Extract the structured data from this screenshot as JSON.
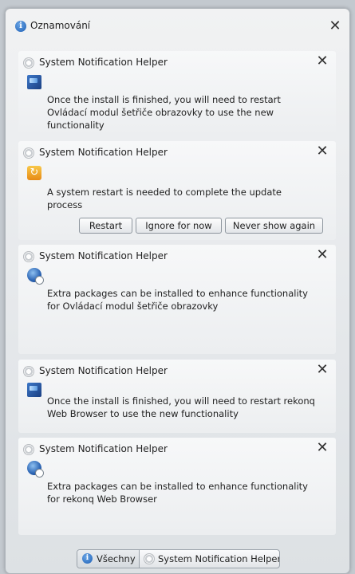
{
  "window": {
    "title": "Oznamování",
    "close_glyph": "✕"
  },
  "notifications": [
    {
      "app": "System Notification Helper",
      "icon": "monitor-icon",
      "message": "Once the install is finished, you will need to restart Ovládací modul šetřiče obrazovky to use the new functionality",
      "close_glyph": "✕"
    },
    {
      "app": "System Notification Helper",
      "icon": "restart-icon",
      "message": "A system restart is needed to complete the update process",
      "close_glyph": "✕",
      "actions": [
        "Restart",
        "Ignore for now",
        "Never show again"
      ]
    },
    {
      "app": "System Notification Helper",
      "icon": "globe-icon",
      "message": "Extra packages can be installed to enhance functionality for Ovládací modul šetřiče obrazovky",
      "close_glyph": "✕"
    },
    {
      "app": "System Notification Helper",
      "icon": "monitor-icon",
      "message": "Once the install is finished, you will need to restart rekonq Web Browser to use the new functionality",
      "close_glyph": "✕"
    },
    {
      "app": "System Notification Helper",
      "icon": "globe-icon",
      "message": "Extra packages can be installed to enhance functionality for rekonq Web Browser",
      "close_glyph": "✕"
    }
  ],
  "filter_bar": {
    "all_label": "Všechny",
    "helper_label": "System Notification Helper"
  },
  "colors": {
    "accent": "#1d5fb5",
    "background": "#c3c9cf"
  }
}
